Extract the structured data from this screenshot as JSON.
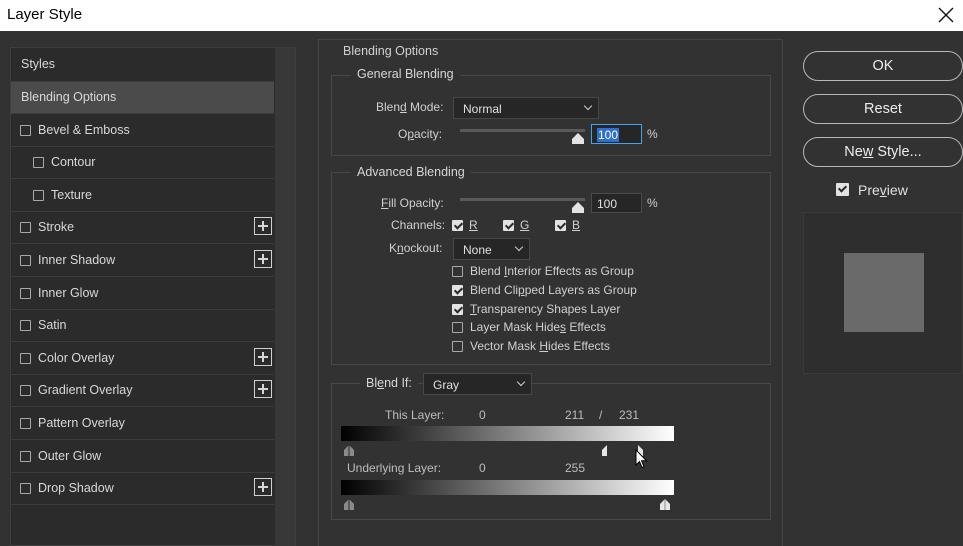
{
  "window": {
    "title": "Layer Style"
  },
  "styles_panel": {
    "header": "Styles",
    "items": [
      {
        "label": "Blending Options",
        "checkbox": false,
        "plus": false,
        "selected": true,
        "indent": 0
      },
      {
        "label": "Bevel & Emboss",
        "checkbox": true,
        "checked": false,
        "plus": false,
        "indent": 0
      },
      {
        "label": "Contour",
        "checkbox": true,
        "checked": false,
        "plus": false,
        "indent": 1
      },
      {
        "label": "Texture",
        "checkbox": true,
        "checked": false,
        "plus": false,
        "indent": 1
      },
      {
        "label": "Stroke",
        "checkbox": true,
        "checked": false,
        "plus": true,
        "indent": 0
      },
      {
        "label": "Inner Shadow",
        "checkbox": true,
        "checked": false,
        "plus": true,
        "indent": 0
      },
      {
        "label": "Inner Glow",
        "checkbox": true,
        "checked": false,
        "plus": false,
        "indent": 0
      },
      {
        "label": "Satin",
        "checkbox": true,
        "checked": false,
        "plus": false,
        "indent": 0
      },
      {
        "label": "Color Overlay",
        "checkbox": true,
        "checked": false,
        "plus": true,
        "indent": 0
      },
      {
        "label": "Gradient Overlay",
        "checkbox": true,
        "checked": false,
        "plus": true,
        "indent": 0
      },
      {
        "label": "Pattern Overlay",
        "checkbox": true,
        "checked": false,
        "plus": false,
        "indent": 0
      },
      {
        "label": "Outer Glow",
        "checkbox": true,
        "checked": false,
        "plus": false,
        "indent": 0
      },
      {
        "label": "Drop Shadow",
        "checkbox": true,
        "checked": false,
        "plus": true,
        "indent": 0
      }
    ]
  },
  "blending": {
    "title": "Blending Options",
    "general": {
      "title": "General Blending",
      "blend_mode_label_pre": "Blen",
      "blend_mode_label_u": "d",
      "blend_mode_label_post": " Mode:",
      "blend_mode_value": "Normal",
      "opacity_label_pre": "O",
      "opacity_label_u": "p",
      "opacity_label_post": "acity:",
      "opacity_value": "100",
      "opacity_fraction": 1.0,
      "percent": "%"
    },
    "advanced": {
      "title": "Advanced Blending",
      "fill_label_u": "F",
      "fill_label_post": "ill Opacity:",
      "fill_value": "100",
      "fill_fraction": 1.0,
      "percent": "%",
      "channels_label": "Channels:",
      "channels": [
        {
          "label": "R",
          "checked": true
        },
        {
          "label": "G",
          "checked": true
        },
        {
          "label": "B",
          "checked": true
        }
      ],
      "knockout_label_pre": "K",
      "knockout_label_u": "n",
      "knockout_label_post": "ockout:",
      "knockout_value": "None",
      "options": [
        {
          "pre": "Blend ",
          "u": "I",
          "post": "nterior Effects as Group",
          "checked": false
        },
        {
          "pre": "Blend Cli",
          "u": "p",
          "post": "ped Layers as Group",
          "checked": true
        },
        {
          "pre": "",
          "u": "T",
          "post": "ransparency Shapes Layer",
          "checked": true
        },
        {
          "pre": "Layer Mask Hide",
          "u": "s",
          "post": " Effects",
          "checked": false
        },
        {
          "pre": "Vector Mask ",
          "u": "H",
          "post": "ides Effects",
          "checked": false
        }
      ]
    },
    "blend_if": {
      "label_pre": "Bl",
      "label_u": "e",
      "label_post": "nd If:",
      "value": "Gray",
      "this_layer": {
        "label": "This Layer:",
        "min": "0",
        "max_left": "211",
        "slash": "/",
        "max_right": "231"
      },
      "underlying_layer": {
        "label": "Underlying Layer:",
        "min": "0",
        "max": "255"
      }
    }
  },
  "buttons": {
    "ok": "OK",
    "reset": "Reset",
    "new_style_pre": "Ne",
    "new_style_u": "w",
    "new_style_post": " Style...",
    "preview_pre": "Pre",
    "preview_u": "v",
    "preview_post": "iew",
    "preview_checked": true
  },
  "colors": {
    "background": "#323232",
    "selected_row": "#4b4b4b",
    "focus": "#4aa0f0",
    "preview_swatch": "#6a6a6a"
  },
  "icons": [
    "close-icon",
    "plus-icon",
    "checkbox-icon",
    "chevron-down-icon",
    "slider-thumb-icon",
    "mouse-cursor-icon"
  ]
}
